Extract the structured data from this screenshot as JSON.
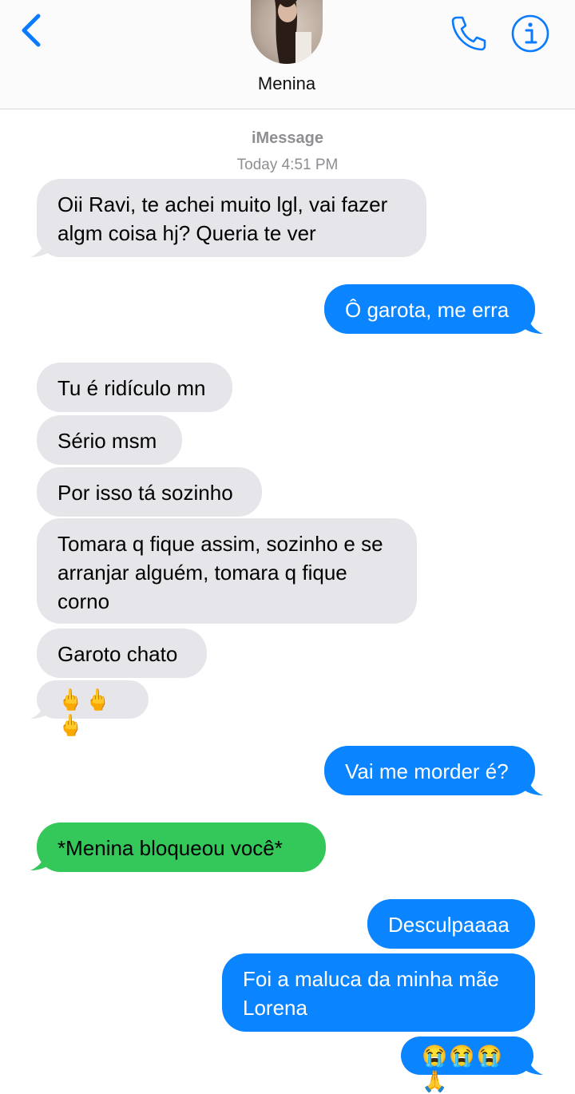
{
  "header": {
    "contact_name": "Menina"
  },
  "conversation": {
    "service": "iMessage",
    "timestamp": "Today 4:51 PM",
    "messages": [
      {
        "from": "them",
        "text": "Oii Ravi, te achei muito lgl, vai fazer algm coisa hj? Queria te ver"
      },
      {
        "from": "me",
        "text": "Ô garota, me erra"
      },
      {
        "from": "them",
        "text": "Tu é ridículo mn"
      },
      {
        "from": "them",
        "text": "Sério msm"
      },
      {
        "from": "them",
        "text": "Por isso tá sozinho"
      },
      {
        "from": "them",
        "text": "Tomara q fique assim, sozinho e se arranjar alguém, tomara q fique corno"
      },
      {
        "from": "them",
        "text": "Garoto chato"
      },
      {
        "from": "them",
        "text": "🖕🖕🖕"
      },
      {
        "from": "me",
        "text": "Vai me morder é?"
      },
      {
        "from": "them",
        "text": "*Menina bloqueou você*"
      },
      {
        "from": "me",
        "text": "Desculpaaaa"
      },
      {
        "from": "me",
        "text": "Foi a maluca da minha mãe Lorena"
      },
      {
        "from": "me",
        "text": "😭😭😭🙏"
      }
    ]
  },
  "colors": {
    "incoming": "#e5e5ea",
    "outgoing": "#0a84ff",
    "blocked_notice": "#34c759",
    "accent": "#0a7aff"
  },
  "icons": [
    "back-chevron-icon",
    "phone-icon",
    "info-icon"
  ]
}
